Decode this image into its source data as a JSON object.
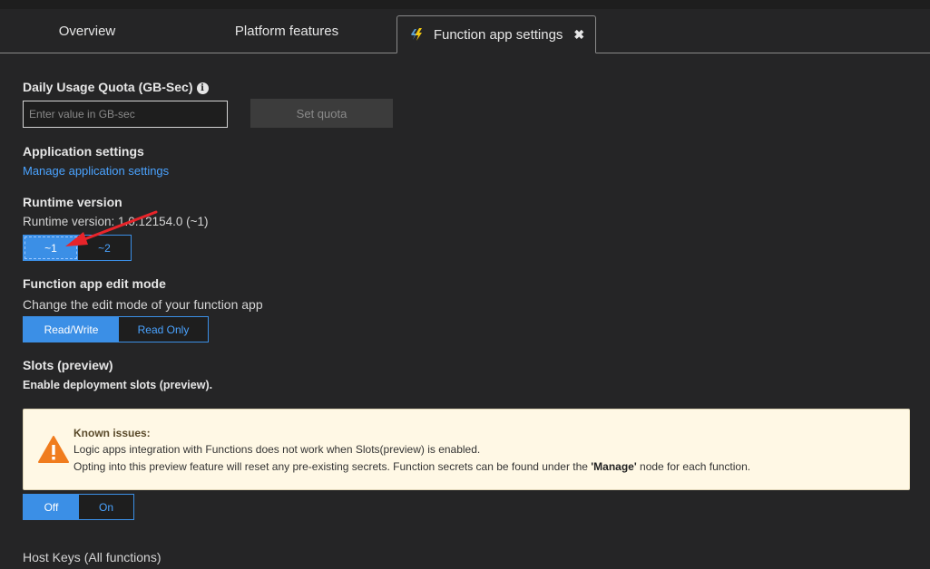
{
  "tabs": [
    {
      "label": "Overview"
    },
    {
      "label": "Platform features"
    },
    {
      "label": "Function app settings"
    }
  ],
  "quota": {
    "title": "Daily Usage Quota (GB-Sec)",
    "placeholder": "Enter value in GB-sec",
    "button": "Set quota"
  },
  "app_settings": {
    "title": "Application settings",
    "link": "Manage application settings"
  },
  "runtime": {
    "title": "Runtime version",
    "current": "Runtime version: 1.0.12154.0 (~1)",
    "options": [
      "~1",
      "~2"
    ],
    "selected": "~1"
  },
  "edit_mode": {
    "title": "Function app edit mode",
    "description": "Change the edit mode of your function app",
    "options": [
      "Read/Write",
      "Read Only"
    ],
    "selected": "Read/Write"
  },
  "slots": {
    "title": "Slots (preview)",
    "description": "Enable deployment slots (preview).",
    "options": [
      "Off",
      "On"
    ],
    "selected": "Off"
  },
  "known_issues": {
    "title": "Known issues:",
    "line1": "Logic apps integration with Functions does not work when Slots(preview) is enabled.",
    "line2_prefix": "Opting into this preview feature will reset any pre-existing secrets. Function secrets can be found under the ",
    "line2_bold": "'Manage'",
    "line2_suffix": " node for each function."
  },
  "host_keys": {
    "title": "Host Keys (All functions)"
  },
  "colors": {
    "accent": "#3b8fe6",
    "link": "#4aa3ff",
    "warning_bg": "#fff8e5",
    "warning_icon": "#f07c1e",
    "annotation_arrow": "#e8242a"
  },
  "icons": {
    "info": "info-icon",
    "bolt": "function-bolt-icon",
    "close": "close-icon",
    "warning": "warning-icon"
  }
}
